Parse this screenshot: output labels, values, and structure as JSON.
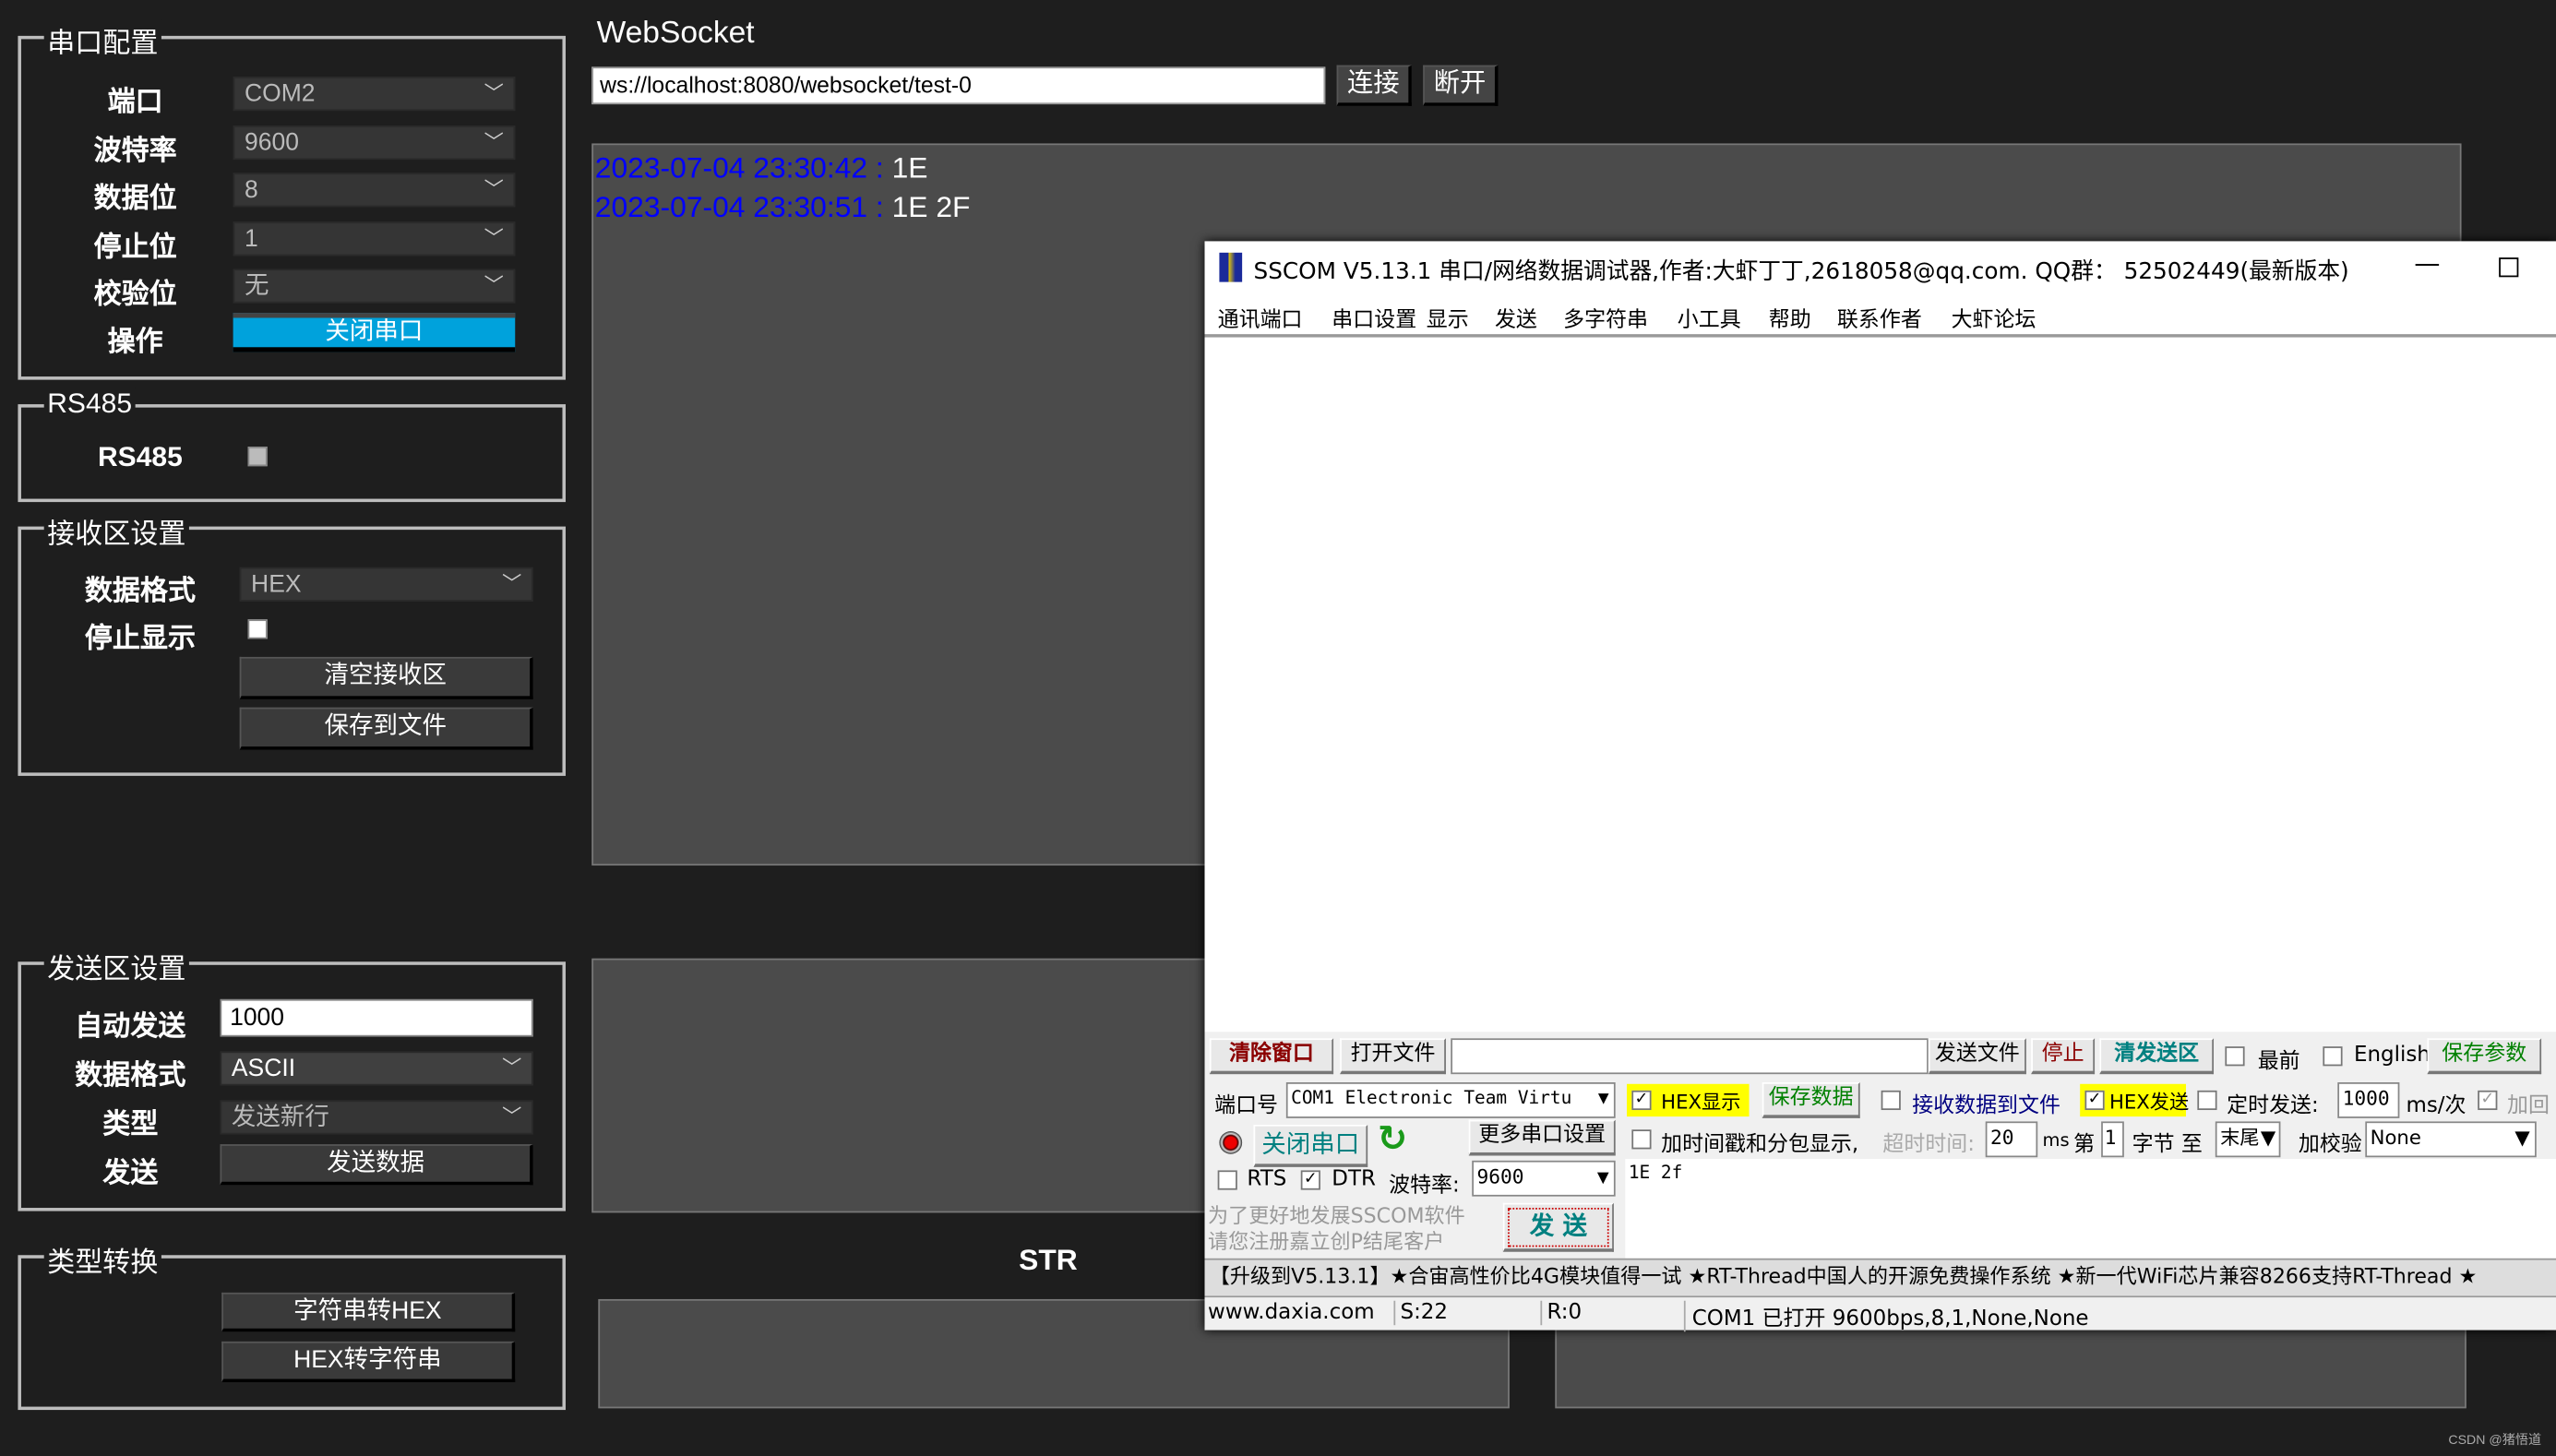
{
  "serial_config": {
    "legend": "串口配置",
    "rows": [
      {
        "label": "端口",
        "value": "COM2"
      },
      {
        "label": "波特率",
        "value": "9600"
      },
      {
        "label": "数据位",
        "value": "8"
      },
      {
        "label": "停止位",
        "value": "1"
      },
      {
        "label": "校验位",
        "value": "无"
      }
    ],
    "action_label": "操作",
    "action_button": "关闭串口",
    "accent": "#00a2dc"
  },
  "rs485": {
    "legend": "RS485",
    "label": "RS485",
    "checked": false
  },
  "receive_settings": {
    "legend": "接收区设置",
    "format_label": "数据格式",
    "format_value": "HEX",
    "stop_label": "停止显示",
    "clear_button": "清空接收区",
    "save_button": "保存到文件"
  },
  "send_settings": {
    "legend": "发送区设置",
    "auto_label": "自动发送",
    "auto_value": "1000",
    "format_label": "数据格式",
    "format_value": "ASCII",
    "type_label": "类型",
    "type_value": "发送新行",
    "send_label": "发送",
    "send_button": "发送数据"
  },
  "convert": {
    "legend": "类型转换",
    "str_to_hex": "字符串转HEX",
    "hex_to_str": "HEX转字符串"
  },
  "websocket": {
    "title": "WebSocket",
    "url": "ws://localhost:8080/websocket/test-0",
    "connect": "连接",
    "disconnect": "断开",
    "messages": [
      {
        "time": "2023-07-04 23:30:42 : ",
        "data": "1E"
      },
      {
        "time": "2023-07-04 23:30:51 : ",
        "data": "1E 2F"
      }
    ],
    "time_color": "#0000ff"
  },
  "str_label": "STR",
  "watermark": "CSDN @猪悟道",
  "sscom": {
    "title": "SSCOM V5.13.1 串口/网络数据调试器,作者:大虾丁丁,2618058@qq.com. QQ群： 52502449(最新版本)",
    "menu": [
      "通讯端口",
      "串口设置",
      "显示",
      "发送",
      "多字符串",
      "小工具",
      "帮助",
      "联系作者",
      "大虾论坛"
    ],
    "toolbar": {
      "clear": "清除窗口",
      "open_file": "打开文件",
      "send_file": "发送文件",
      "stop": "停止",
      "clear_send": "清发送区",
      "topmost": "最前",
      "english": "English",
      "save_params": "保存参数"
    },
    "port_label": "端口号",
    "port_value": "COM1 Electronic Team Virtu",
    "hex_display": "HEX显示",
    "save_data": "保存数据",
    "recv_to_file": "接收数据到文件",
    "hex_send": "HEX发送",
    "timed_send": "定时发送:",
    "timed_value": "1000",
    "timed_unit": "ms/次",
    "add_enter": "加回",
    "close_port": "关闭串口",
    "more_settings": "更多串口设置",
    "timestamp": "加时间戳和分包显示,",
    "timeout_label": "超时时间:",
    "timeout_value": "20",
    "ms": "ms",
    "nth": "第",
    "nth_value": "1",
    "byte_to": "字节 至",
    "end_value": "末尾",
    "checksum_label": "加校验",
    "checksum_value": "None",
    "rts": "RTS",
    "dtr": "DTR",
    "baud_label": "波特率:",
    "baud_value": "9600",
    "send_text": "1E 2f",
    "promo": "为了更好地发展SSCOM软件\n请您注册嘉立创P结尾客户",
    "send_button": "发  送",
    "marquee": "【升级到V5.13.1】★合宙高性价比4G模块值得一试 ★RT-Thread中国人的开源免费操作系统 ★新一代WiFi芯片兼容8266支持RT-Thread ★",
    "status": {
      "site": "www.daxia.com",
      "s": "S:22",
      "r": "R:0",
      "info": "COM1 已打开  9600bps,8,1,None,None"
    }
  }
}
